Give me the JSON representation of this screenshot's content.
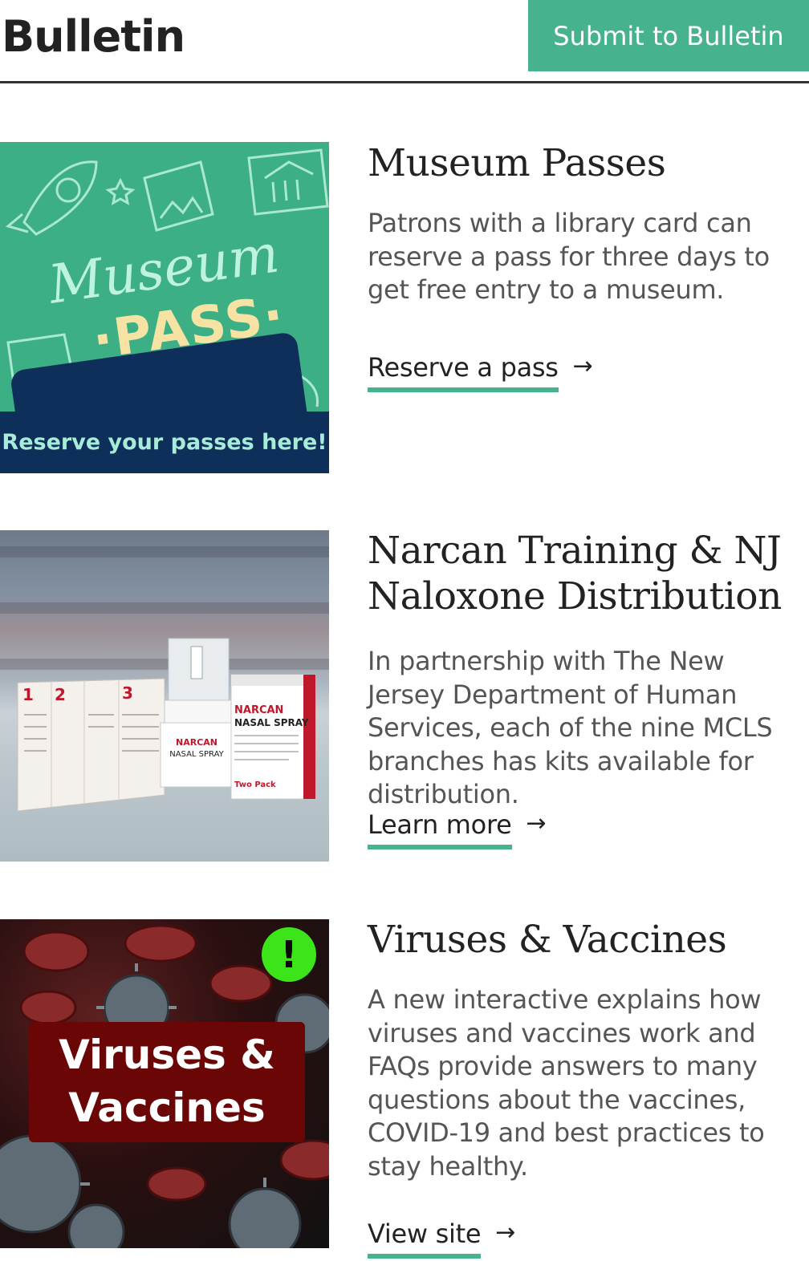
{
  "header": {
    "title": "Bulletin",
    "submit_label": "Submit to Bulletin"
  },
  "colors": {
    "accent": "#46b38e",
    "museum_navy": "#0f2f5b",
    "virus_red": "#6b0606",
    "alert_green": "#3be51a"
  },
  "cards": [
    {
      "title": "Museum Passes",
      "description": "Patrons with a library card can reserve a pass for three days to get free entry to a museum.",
      "link_label": "Reserve a pass",
      "link_arrow": "→",
      "image": {
        "script_text": "Museum",
        "pass_text": "·PASS·",
        "banner_text": "Reserve your passes here!"
      }
    },
    {
      "title": "Narcan Training & NJ Naloxone Distribution",
      "description": "In partnership with The New Jersey Department of Human Services, each of the nine MCLS branches has kits available for distribution.",
      "link_label": "Learn more",
      "link_arrow": "→",
      "image": {
        "product_brand": "NARCAN",
        "product_name": "NASAL SPRAY",
        "product_pack": "Two Pack"
      }
    },
    {
      "title": "Viruses & Vaccines",
      "description": "A new interactive explains how viruses and vaccines work and FAQs provide answers to many questions about the vaccines, COVID-19 and best practices to stay healthy.",
      "link_label": "View site",
      "link_arrow": "→",
      "image": {
        "line1": "Viruses &",
        "line2": "Vaccines",
        "alert_symbol": "!"
      }
    }
  ]
}
